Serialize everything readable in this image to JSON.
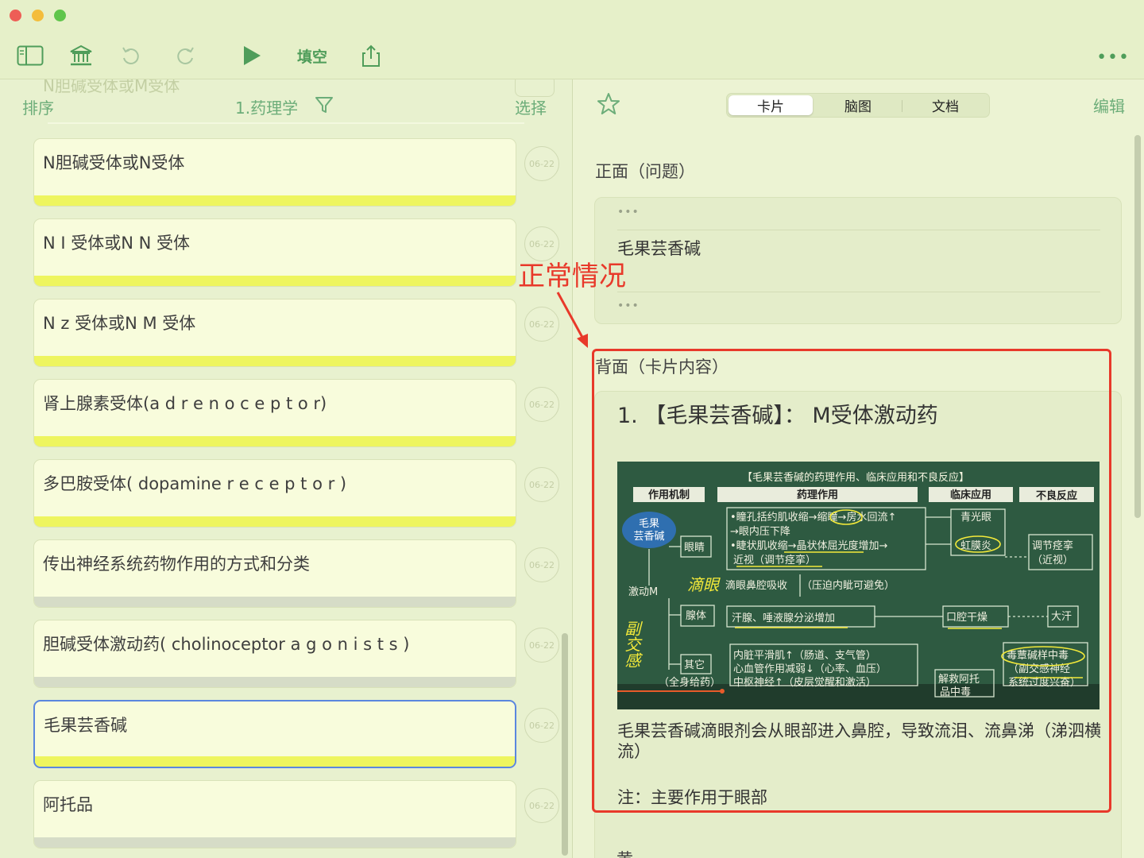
{
  "toolbar": {
    "fill_blank_label": "填空",
    "more_label": "•••"
  },
  "left": {
    "ghost_item": "N胆碱受体或M受体",
    "sort_label": "排序",
    "deck_title": "1.药理学",
    "select_label": "选择",
    "cards": [
      {
        "title": "N胆碱受体或N受体",
        "date": "06-22",
        "bar": "yellow"
      },
      {
        "title": "N I 受体或N N 受体",
        "date": "06-22",
        "bar": "yellow"
      },
      {
        "title": "N z 受体或N M 受体",
        "date": "06-22",
        "bar": "yellow"
      },
      {
        "title": "肾上腺素受体(a d r e n o c e p t o r)",
        "date": "06-22",
        "bar": "yellow"
      },
      {
        "title": "多巴胺受体( dopamine r e c e p t o r )",
        "date": "06-22",
        "bar": "yellow"
      },
      {
        "title": "传出神经系统药物作用的方式和分类",
        "date": "06-22",
        "bar": "gray"
      },
      {
        "title": "胆碱受体激动药( cholinoceptor a g o n i s t s )",
        "date": "06-22",
        "bar": "gray"
      },
      {
        "title": "毛果芸香碱",
        "date": "06-22",
        "bar": "yellow",
        "selected": true
      },
      {
        "title": "阿托品",
        "date": "06-22",
        "bar": "gray"
      }
    ]
  },
  "right": {
    "tabs": [
      "卡片",
      "脑图",
      "文档"
    ],
    "active_tab": "卡片",
    "edit_label": "编辑",
    "front_label": "正面（问题）",
    "front_dots": "•••",
    "front_answer": "毛果芸香碱",
    "back_label": "背面（卡片内容）",
    "back_heading": "1. 【毛果芸香碱】： M受体激动药",
    "diagram": {
      "title": "【毛果芸香碱的药理作用、临床应用和不良反应】",
      "col_mechanism": "作用机制",
      "col_action": "药理作用",
      "col_clinical": "临床应用",
      "col_adverse": "不良反应",
      "drug_line1": "毛果",
      "drug_line2": "芸香碱",
      "agonist": "激动M",
      "eye": "眼睛",
      "gland": "腺体",
      "other": "其它",
      "eye_action1": "•瞳孔括约肌收缩→缩瞳→房水回流↑",
      "eye_action2": "→眼内压下降",
      "eye_action3": "•睫状肌收缩→晶状体屈光度增加→",
      "eye_action4": "近视（调节痉挛）",
      "eye_drop": "滴眼鼻腔吸收",
      "eye_drop_note": "（压迫内眦可避免）",
      "gland_action": "汗腺、唾液腺分泌增加",
      "other1": "内脏平滑肌↑（肠道、支气管）",
      "other2": "心血管作用减弱↓（心率、血压）",
      "other3": "中枢神经↑（皮层觉醒和激活）",
      "systemic": "（全身给药）",
      "glaucoma": "青光眼",
      "iritis": "虹膜炎",
      "dry_mouth": "口腔干燥",
      "atropine": "解救阿托",
      "atropine2": "品中毒",
      "accommodation": "调节痉挛",
      "myopia": "（近视）",
      "sweating": "大汗",
      "poisoning": "毒蕈碱样中毒",
      "parasym": "（副交感神经",
      "parasym2": "系统过度兴奋）",
      "handwritten1": "滴眼",
      "handwritten2": "副交感"
    },
    "desc": "毛果芸香碱滴眼剂会从眼部进入鼻腔，导致流泪、流鼻涕（涕泗横流）",
    "note": "注：主要作用于眼部",
    "cut_text": "黄"
  },
  "annotation": {
    "label": "正常情况",
    "color": "#e8392a"
  },
  "colors": {
    "accent_green": "#4f9d5a",
    "card_bar_yellow": "#eef55f",
    "selected_border": "#5b87df",
    "background": "#ecf3d3"
  }
}
